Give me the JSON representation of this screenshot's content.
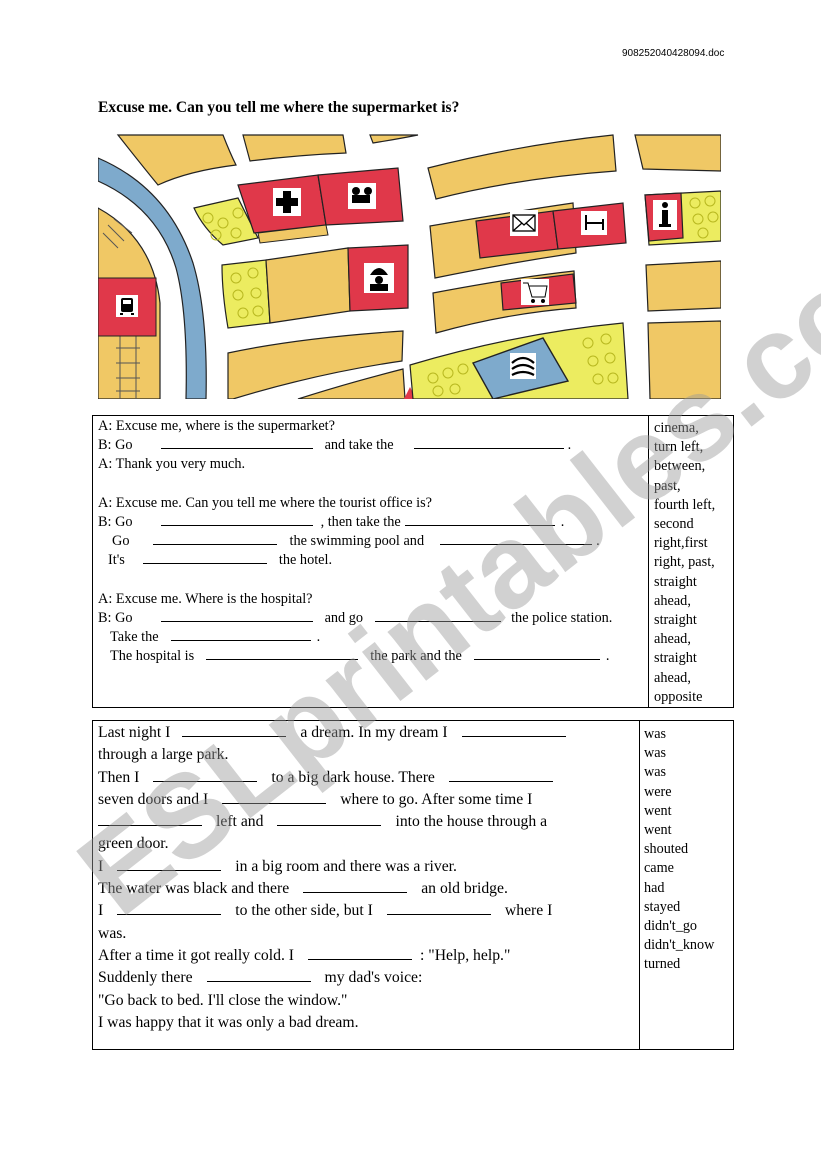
{
  "header": {
    "filename": "908252040428094.doc",
    "title": "Excuse me. Can you tell me where the supermarket is?"
  },
  "map": {
    "icons": [
      "hospital-cross-icon",
      "cinema-camera-icon",
      "post-office-envelope-icon",
      "hotel-bed-icon",
      "tourist-info-icon",
      "police-officer-icon",
      "supermarket-cart-icon",
      "train-station-icon",
      "swimming-pool-waves-icon",
      "you-are-here-triangle-icon"
    ],
    "colors": {
      "road": "#ffffff",
      "block": "#f0c865",
      "building": "#e0384a",
      "park": "#ecec60",
      "river": "#7eaacc"
    }
  },
  "exercise1": {
    "lines": [
      [
        "A: Excuse me, where is the supermarket?"
      ],
      [
        "B: Go",
        "",
        "and take the",
        "",
        "."
      ],
      [
        "A: Thank you very much."
      ],
      [
        ""
      ],
      [
        "A: Excuse me. Can you tell me where the tourist office is?"
      ],
      [
        "B: Go",
        "",
        ", then take the",
        "",
        "."
      ],
      [
        "Go",
        "",
        "the swimming pool and",
        "",
        "."
      ],
      [
        "It's",
        "",
        "the hotel."
      ],
      [
        ""
      ],
      [
        "A: Excuse me. Where is the hospital?"
      ],
      [
        "B: Go",
        "",
        "and go",
        "",
        "the police  station."
      ],
      [
        "Take the",
        "",
        "."
      ],
      [
        "The hospital is",
        "",
        "the park and the",
        "",
        "."
      ]
    ],
    "word_bank": [
      "cinema,",
      "turn left,",
      "between,",
      "past,",
      "fourth left,",
      "second",
      "right,first",
      "right, past,",
      "straight",
      "ahead,",
      "straight",
      "ahead,",
      "straight",
      "ahead,",
      "opposite"
    ]
  },
  "exercise2": {
    "lines": [
      [
        "Last night I",
        "",
        "a dream. In my dream I",
        ""
      ],
      [
        "through a large park."
      ],
      [
        "Then I",
        "",
        "to a big dark house. There",
        ""
      ],
      [
        "seven doors and I",
        "",
        "where to go. After some time I"
      ],
      [
        "",
        "left and",
        "",
        "into the house through a"
      ],
      [
        "green door."
      ],
      [
        "I",
        "",
        "in a big room and there was a river."
      ],
      [
        "The water was black and there",
        "",
        "an old bridge."
      ],
      [
        "I",
        "",
        "to the other side, but I",
        "",
        "where I"
      ],
      [
        "was."
      ],
      [
        "After a time it got really cold. I",
        "",
        ": \"Help, help.\""
      ],
      [
        "Suddenly there",
        "",
        "my dad's voice:"
      ],
      [
        "\"Go back to bed. I'll close the window.\""
      ],
      [
        "I was happy that it was only a bad dream."
      ]
    ],
    "word_bank": [
      "was",
      "was",
      "was",
      "were",
      "went",
      "went",
      "shouted",
      "came",
      "had",
      "stayed",
      "didn't_go",
      "didn't_know",
      "turned"
    ]
  },
  "watermark": {
    "text": "ESLprintables.com"
  }
}
